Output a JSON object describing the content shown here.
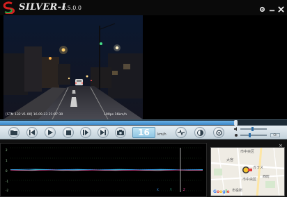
{
  "app": {
    "logo_text": "SILVER-I",
    "version": "0.5.0.0"
  },
  "window_controls": [
    {
      "name": "gear-icon"
    },
    {
      "name": "minimize-icon"
    },
    {
      "name": "close-icon"
    }
  ],
  "video": {
    "overlay_left": "[STM 132 V1.00] 16.09.23 21:07:30",
    "overlay_right": "100ps 16km/h",
    "seek_progress": 0.82
  },
  "controls": {
    "buttons": [
      {
        "name": "open-folder-icon"
      },
      {
        "name": "previous-file-icon"
      },
      {
        "name": "play-icon"
      },
      {
        "name": "stop-icon"
      },
      {
        "name": "pause-icon"
      },
      {
        "name": "next-file-icon"
      },
      {
        "name": "snapshot-icon"
      }
    ],
    "speed_value": "16",
    "speed_unit": "km/h",
    "extra_buttons": [
      {
        "name": "gsensor-graph-icon"
      },
      {
        "name": "brightness-icon"
      },
      {
        "name": "zoom-icon"
      }
    ],
    "volume_level": 0.45,
    "brightness_level": 0.35,
    "toggle_label": "Ch"
  },
  "graph": {
    "y_ticks": [
      "2",
      "1",
      "0",
      "-1",
      "-2"
    ],
    "legend": [
      {
        "label": "X",
        "color": "#3aa0ff"
      },
      {
        "label": "Y",
        "color": "#35d0a0"
      },
      {
        "label": "Z",
        "color": "#ff4aa0"
      }
    ],
    "close_label": "×"
  },
  "map": {
    "close_label": "×",
    "labels": [
      "市中央区",
      "ガラス",
      "大宮",
      "市中央区",
      "西町",
      "市役所"
    ],
    "logo": "Google"
  }
}
